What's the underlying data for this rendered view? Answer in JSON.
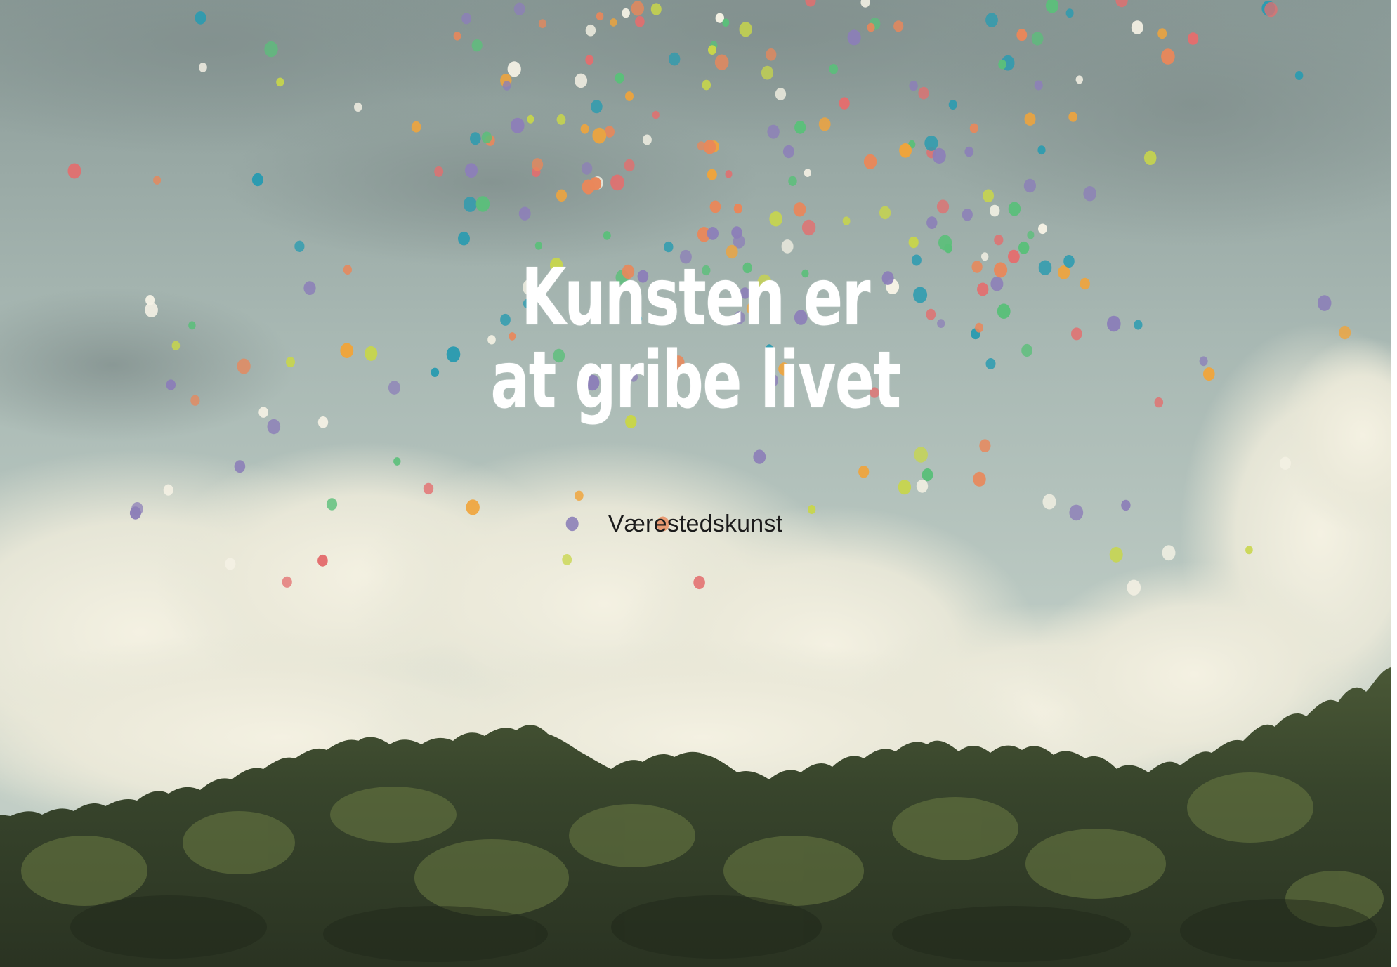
{
  "cover": {
    "headline_line1": "Kunsten er",
    "headline_line2": "at gribe livet",
    "subtitle": "Værestedskunst"
  },
  "colors": {
    "sky_top": "#8a9a97",
    "sky_mid": "#b9c9c4",
    "cloud": "#eceadb",
    "foliage_dark": "#2f3a29",
    "foliage_light": "#6a7a45",
    "headline": "#ffffff",
    "subtitle": "#1c1c1c",
    "balloons": [
      "#e9875a",
      "#2a9bb0",
      "#c8d64a",
      "#e36e6e",
      "#f0a43b",
      "#8c7fb8",
      "#f4f1e4",
      "#5bbf7a"
    ]
  }
}
